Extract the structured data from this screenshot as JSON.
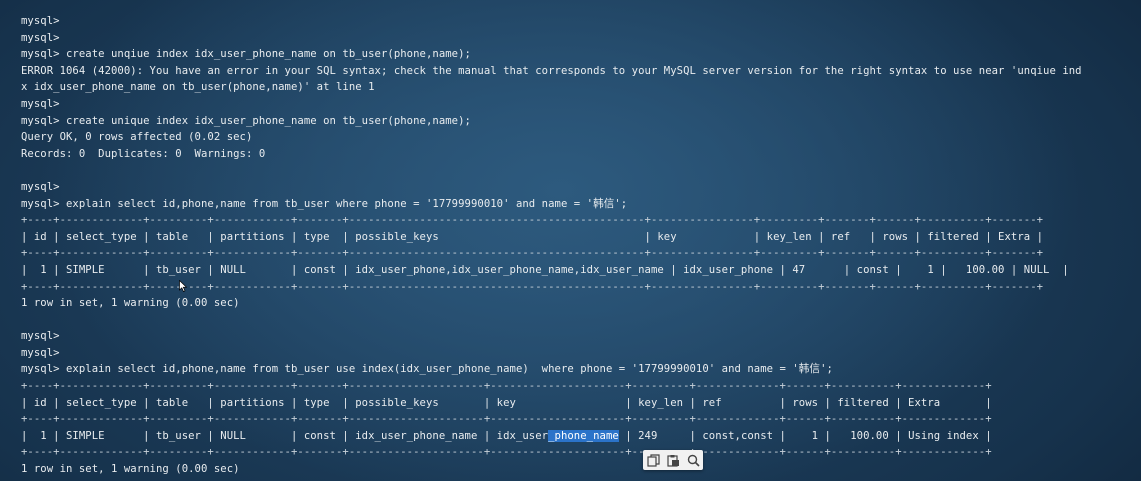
{
  "terminal": {
    "lines": [
      {
        "text": "mysql>"
      },
      {
        "text": "mysql>"
      },
      {
        "text": "mysql> create unqiue index idx_user_phone_name on tb_user(phone,name);"
      },
      {
        "text": "ERROR 1064 (42000): You have an error in your SQL syntax; check the manual that corresponds to your MySQL server version for the right syntax to use near 'unqiue ind"
      },
      {
        "text": "x idx_user_phone_name on tb_user(phone,name)' at line 1"
      },
      {
        "text": "mysql>"
      },
      {
        "text": "mysql> create unique index idx_user_phone_name on tb_user(phone,name);"
      },
      {
        "text": "Query OK, 0 rows affected (0.02 sec)"
      },
      {
        "text": "Records: 0  Duplicates: 0  Warnings: 0"
      },
      {
        "text": ""
      },
      {
        "text": "mysql>"
      },
      {
        "text": "mysql> explain select id,phone,name from tb_user where phone = '17799990010' and name = '韩信';"
      },
      {
        "text": "+----+-------------+---------+------------+-------+----------------------------------------------+----------------+---------+-------+------+----------+-------+",
        "border": true
      },
      {
        "text": "| id | select_type | table   | partitions | type  | possible_keys                                | key            | key_len | ref   | rows | filtered | Extra |"
      },
      {
        "text": "+----+-------------+---------+------------+-------+----------------------------------------------+----------------+---------+-------+------+----------+-------+",
        "border": true
      },
      {
        "text": "|  1 | SIMPLE      | tb_user | NULL       | const | idx_user_phone,idx_user_phone_name,idx_user_name | idx_user_phone | 47      | const |    1 |   100.00 | NULL  |"
      },
      {
        "text": "+----+-------------+---------+------------+-------+----------------------------------------------+----------------+---------+-------+------+----------+-------+",
        "border": true
      },
      {
        "text": "1 row in set, 1 warning (0.00 sec)"
      },
      {
        "text": ""
      },
      {
        "text": "mysql>"
      },
      {
        "text": "mysql>"
      },
      {
        "text": "mysql> explain select id,phone,name from tb_user use index(idx_user_phone_name)  where phone = '17799990010' and name = '韩信';"
      },
      {
        "text": "+----+-------------+---------+------------+-------+---------------------+---------------------+---------+-------------+------+----------+-------------+",
        "border": true
      },
      {
        "text": "| id | select_type | table   | partitions | type  | possible_keys       | key                 | key_len | ref         | rows | filtered | Extra       |"
      },
      {
        "text": "+----+-------------+---------+------------+-------+---------------------+---------------------+---------+-------------+------+----------+-------------+",
        "border": true
      },
      {
        "segments": [
          {
            "text": "|  1 | SIMPLE      | tb_user | NULL       | const | idx_user_phone_name | idx_user"
          },
          {
            "text": "_phone_name",
            "selected": true
          },
          {
            "text": " | 249     | const,const |    1 |   100.00 | Using index |"
          }
        ]
      },
      {
        "text": "+----+-------------+---------+------------+-------+---------------------+---------------------+---------+-------------+------+----------+-------------+",
        "border": true
      },
      {
        "text": "1 row in set, 1 warning (0.00 sec)"
      }
    ]
  },
  "toolbar": {
    "icons": [
      "copy-icon",
      "paste-icon",
      "search-icon"
    ]
  },
  "colors": {
    "background": "#1b3a56",
    "text": "#e8ecef",
    "selection": "#2b73c9"
  }
}
